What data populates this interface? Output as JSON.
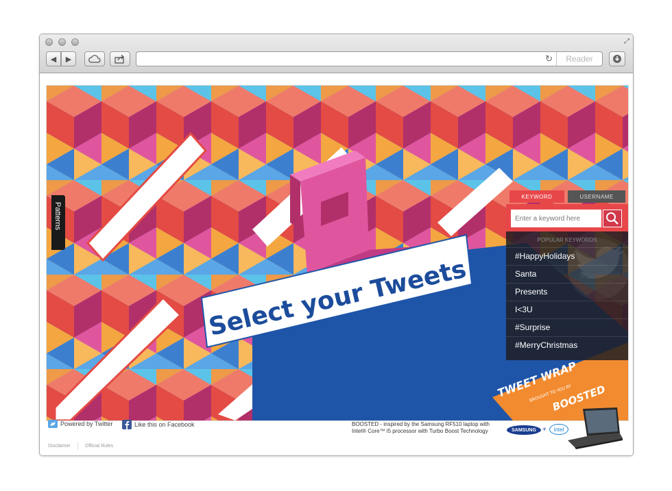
{
  "browser": {
    "reader_label": "Reader"
  },
  "page": {
    "headline": "Select your Tweets",
    "patterns_label": "Patterns",
    "logo_line1": "TWEET WRAP",
    "logo_line2": "BROUGHT TO YOU BY",
    "logo_line3": "BOOSTED"
  },
  "panel": {
    "tabs": [
      "KEYWORD",
      "USERNAME"
    ],
    "search_placeholder": "Enter a keyword here",
    "popular_title": "POPULAR KEYWORDS",
    "keywords": [
      "#HappyHolidays",
      "Santa",
      "Presents",
      "I<3U",
      "#Surprise",
      "#MerryChristmas"
    ]
  },
  "footer": {
    "powered": "Powered by Twitter",
    "facebook": "Like this on Facebook",
    "disclaimer": "Disclaimer",
    "rules": "Official Rules",
    "boosted_text": "BOOSTED - inspired by the Samsung RF510 laptop with Intel® Core™ i5 processor with Turbo Boost Technology",
    "samsung": "SAMSUNG",
    "plus": "+",
    "intel": "intel"
  },
  "colors": {
    "accent": "#e8474a",
    "headline_blue": "#1c4c9b",
    "pink": "#e0569e",
    "orange": "#f4a640"
  }
}
